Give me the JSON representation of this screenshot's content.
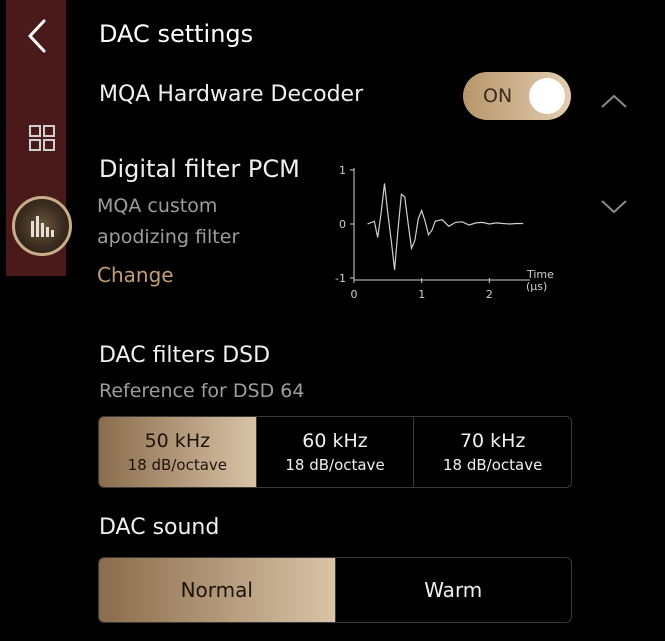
{
  "header": {
    "title": "DAC settings"
  },
  "mqa": {
    "label": "MQA Hardware Decoder",
    "toggle_label": "ON",
    "toggle_on": true
  },
  "digital_filter": {
    "title": "Digital filter PCM",
    "filter_name_line1": "MQA custom",
    "filter_name_line2": "apodizing filter",
    "change_label": "Change"
  },
  "chart_data": {
    "type": "line",
    "xlabel": "Time",
    "xunit": "(µs)",
    "xlim": [
      0,
      2.6
    ],
    "ylim": [
      -1,
      1
    ],
    "x_ticks": [
      "0",
      "1",
      "2"
    ],
    "y_ticks": [
      "1",
      "0",
      "-1"
    ],
    "series": [
      {
        "x": [
          0.2,
          0.3,
          0.35,
          0.4,
          0.45,
          0.5,
          0.55,
          0.6,
          0.65,
          0.7,
          0.75,
          0.8,
          0.85,
          0.9,
          0.95,
          1.0,
          1.05,
          1.1,
          1.15,
          1.2,
          1.3,
          1.4,
          1.5,
          1.6,
          1.7,
          1.8,
          1.9,
          2.0,
          2.1,
          2.2,
          2.3,
          2.4,
          2.5
        ],
        "y": [
          0.0,
          0.05,
          -0.25,
          0.2,
          0.75,
          0.2,
          -0.3,
          -0.85,
          -0.1,
          0.55,
          0.5,
          0.0,
          -0.45,
          -0.3,
          0.1,
          0.25,
          0.05,
          -0.2,
          -0.12,
          0.05,
          0.08,
          -0.04,
          0.03,
          0.04,
          -0.02,
          0.02,
          0.03,
          0.0,
          0.02,
          0.01,
          0.0,
          0.01,
          0.01
        ]
      }
    ]
  },
  "dsd": {
    "title": "DAC filters DSD",
    "subtitle": "Reference for DSD 64",
    "options": [
      {
        "main": "50 kHz",
        "sub": "18 dB/octave",
        "selected": true
      },
      {
        "main": "60 kHz",
        "sub": "18 dB/octave",
        "selected": false
      },
      {
        "main": "70 kHz",
        "sub": "18 dB/octave",
        "selected": false
      }
    ]
  },
  "sound": {
    "title": "DAC sound",
    "options": [
      {
        "label": "Normal",
        "selected": true
      },
      {
        "label": "Warm",
        "selected": false
      }
    ]
  },
  "colors": {
    "accent": "#c49e77",
    "sidebar": "#4a1a1a",
    "selected_start": "#8a6c4c",
    "selected_end": "#d9c3a6"
  }
}
